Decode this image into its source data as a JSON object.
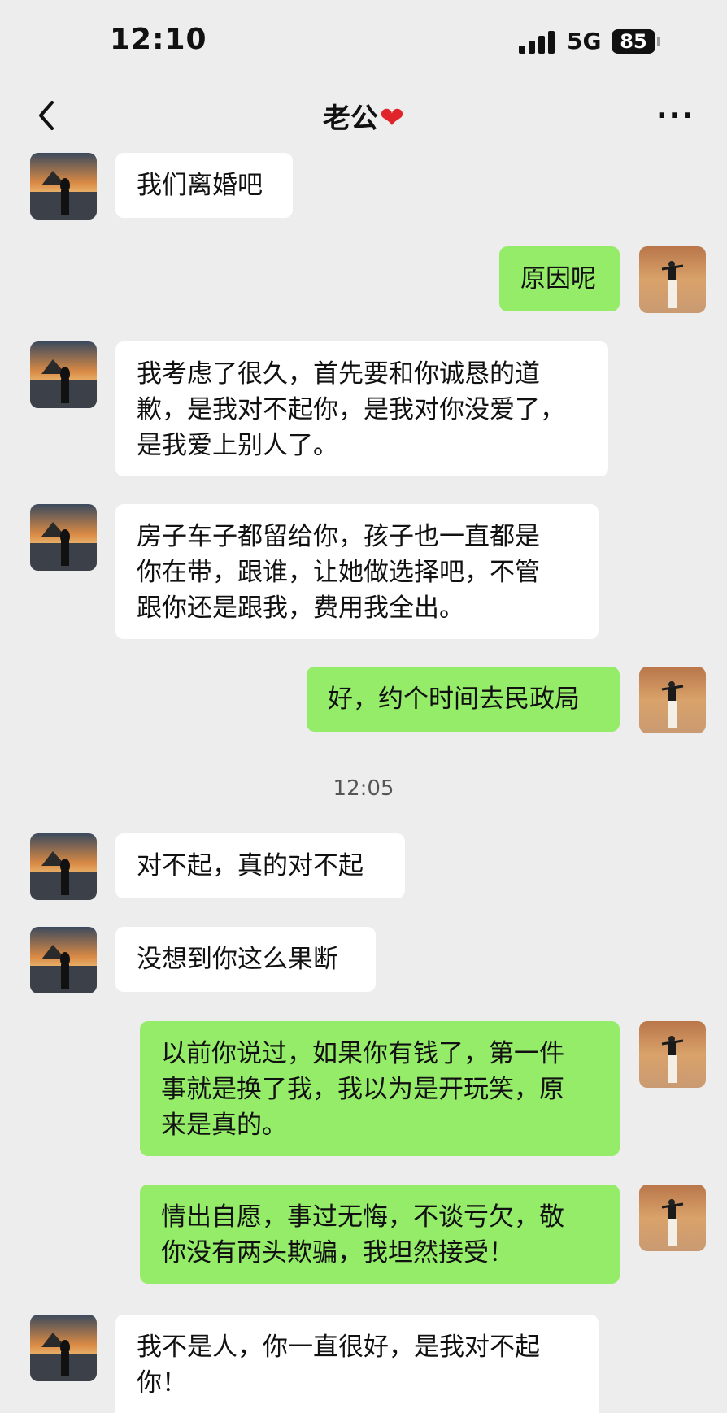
{
  "status": {
    "time": "12:10",
    "network": "5G",
    "battery": "85"
  },
  "header": {
    "title": "老公",
    "heart": "❤",
    "more": "···"
  },
  "messages": [
    {
      "side": "left",
      "text": "我们离婚吧"
    },
    {
      "side": "right",
      "text": "原因呢"
    },
    {
      "side": "left",
      "text": "我考虑了很久，首先要和你诚恳的道\n歉，是我对不起你，是我对你没爱了，\n是我爱上别人了。"
    },
    {
      "side": "left",
      "text": "房子车子都留给你，孩子也一直都是\n你在带，跟谁，让她做选择吧，不管\n跟你还是跟我，费用我全出。"
    },
    {
      "side": "right",
      "text": "好，约个时间去民政局"
    },
    {
      "side": "left",
      "text": "对不起，真的对不起"
    },
    {
      "side": "left",
      "text": "没想到你这么果断"
    },
    {
      "side": "right",
      "text": "以前你说过，如果你有钱了，第一件\n事就是换了我，我以为是开玩笑，原\n来是真的。"
    },
    {
      "side": "right",
      "text": "情出自愿，事过无悔，不谈亏欠，敬\n你没有两头欺骗，我坦然接受！"
    },
    {
      "side": "left",
      "text": "我不是人，你一直很好，是我对不起\n你！"
    }
  ],
  "time_separator": "12:05"
}
